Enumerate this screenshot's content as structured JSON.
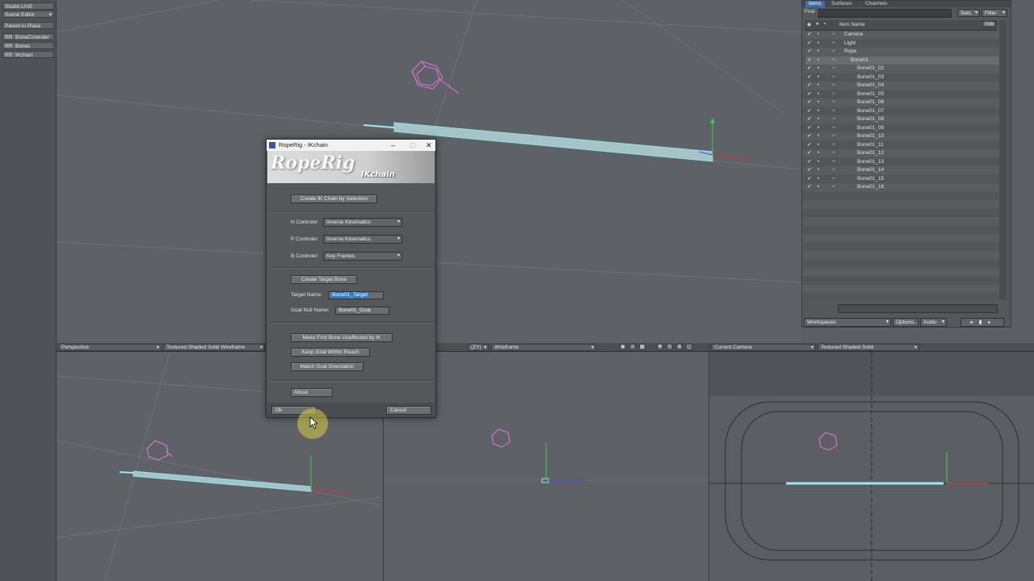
{
  "left_panel": {
    "items": [
      "Studio LIVE",
      "Scene Editor",
      "Parent in Place",
      "RR_BoneControler",
      "RR_Bones",
      "RR_IKchain"
    ]
  },
  "items_panel": {
    "tabs": [
      "Items",
      "Surfaces",
      "Channels"
    ],
    "find_label": "Find",
    "sets_label": "Sets",
    "filter_label": "Filter",
    "column_header": "Item Name",
    "hide_label": "hide",
    "rows": [
      {
        "name": "Camera",
        "indent": 1
      },
      {
        "name": "Light",
        "indent": 1
      },
      {
        "name": "Rope",
        "indent": 1
      },
      {
        "name": "Bone01",
        "indent": 2,
        "selected": true
      },
      {
        "name": "Bone01_02",
        "indent": 3
      },
      {
        "name": "Bone01_03",
        "indent": 3
      },
      {
        "name": "Bone01_04",
        "indent": 3
      },
      {
        "name": "Bone01_05",
        "indent": 3
      },
      {
        "name": "Bone01_06",
        "indent": 3
      },
      {
        "name": "Bone01_07",
        "indent": 3
      },
      {
        "name": "Bone01_08",
        "indent": 3
      },
      {
        "name": "Bone01_09",
        "indent": 3
      },
      {
        "name": "Bone01_10",
        "indent": 3
      },
      {
        "name": "Bone01_11",
        "indent": 3
      },
      {
        "name": "Bone01_12",
        "indent": 3
      },
      {
        "name": "Bone01_13",
        "indent": 3
      },
      {
        "name": "Bone01_14",
        "indent": 3
      },
      {
        "name": "Bone01_15",
        "indent": 3
      },
      {
        "name": "Bone01_16",
        "indent": 3
      }
    ],
    "bottom": {
      "workspaces": "Workspaces",
      "options": "Options...",
      "audio": "Audio"
    }
  },
  "dialog": {
    "title": "RopeRig - IKchain",
    "logo_text": "RopeRig",
    "logo_sub": "IKchain",
    "create_ik_chain": "Create IK Chain by Selection",
    "h_label": "H Controler:",
    "h_value": "Inverse Kinematics",
    "p_label": "P Controler:",
    "p_value": "Inverse Kinematics",
    "b_label": "B Controler:",
    "b_value": "Key Frames",
    "create_target": "Create Target Bone",
    "target_name_label": "Target Name:",
    "target_name_value": "Bone01_Target",
    "goal_null_label": "Goal Null Name:",
    "goal_null_value": "Bone01_Goal",
    "make_first": "Make First Bone Unaffected by IK",
    "keep_goal": "Keep Goal Within Reach",
    "match_goal": "Match Goal Orientation",
    "about": "About",
    "ok": "Ok",
    "cancel": "Cancel"
  },
  "viewports": {
    "left": {
      "view": "Perspective",
      "mode": "Textured Shaded Solid Wireframe"
    },
    "middle": {
      "view": "(ZY)",
      "mode": "Wireframe"
    },
    "right": {
      "view": "Current Camera",
      "mode": "Textured Shaded Solid"
    }
  },
  "colors": {
    "wire": "#9fe7ee",
    "null": "#e079e0",
    "axis_green": "#2fd34a",
    "axis_red": "#e03030",
    "axis_blue": "#3050f0"
  }
}
